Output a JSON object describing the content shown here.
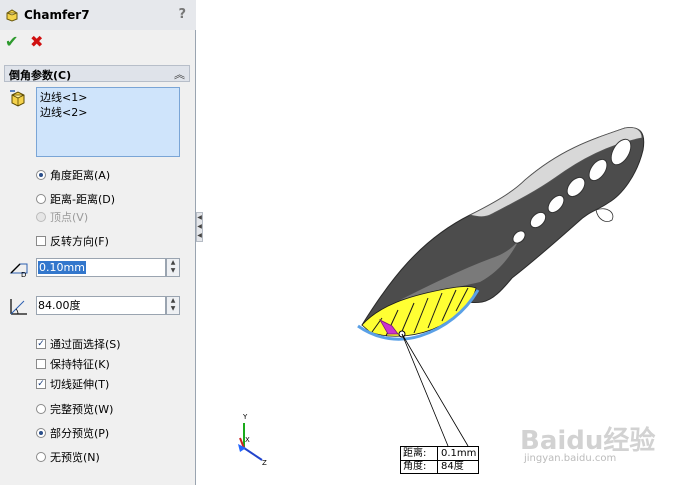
{
  "feature": {
    "title": "Chamfer7",
    "help": "?"
  },
  "actions": {
    "ok": "✔",
    "cancel": "✖"
  },
  "group": {
    "title": "倒角参数(C)",
    "collapse": "︽"
  },
  "selection": {
    "items": [
      "边线<1>",
      "边线<2>"
    ]
  },
  "types": [
    {
      "label": "角度距离(A)",
      "selected": true,
      "enabled": true
    },
    {
      "label": "距离-距离(D)",
      "selected": false,
      "enabled": true
    },
    {
      "label": "顶点(V)",
      "selected": false,
      "enabled": false
    }
  ],
  "flip": {
    "label": "反转方向(F)",
    "checked": false
  },
  "distance": {
    "value": "0.10mm"
  },
  "angle": {
    "value": "84.00度"
  },
  "options": [
    {
      "label": "通过面选择(S)",
      "checked": true
    },
    {
      "label": "保持特征(K)",
      "checked": false
    },
    {
      "label": "切线延伸(T)",
      "checked": true
    }
  ],
  "preview": [
    {
      "label": "完整预览(W)",
      "selected": false
    },
    {
      "label": "部分预览(P)",
      "selected": true
    },
    {
      "label": "无预览(N)",
      "selected": false
    }
  ],
  "callout": {
    "distance_label": "距离:",
    "distance_value": "0.1mm",
    "angle_label": "角度:",
    "angle_value": "84度"
  },
  "triad": {
    "x": "X",
    "y": "Y",
    "z": "Z"
  },
  "watermark": {
    "logo": "Baidu经验",
    "url": "jingyan.baidu.com"
  },
  "colors": {
    "accent": "#3377cc",
    "preview_yellow": "#ffff33",
    "selection_magenta": "#cc33cc"
  }
}
